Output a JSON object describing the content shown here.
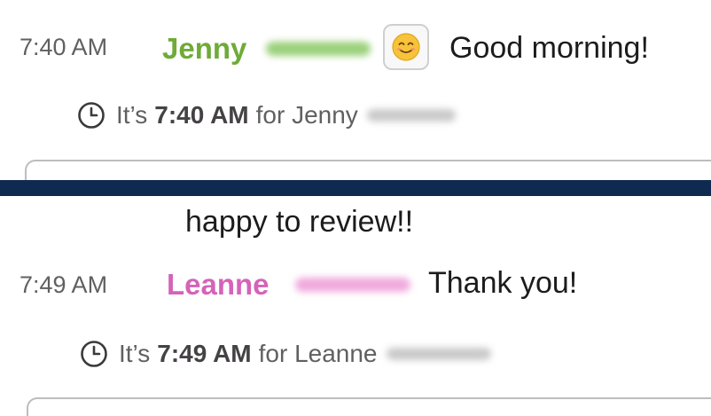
{
  "message1": {
    "timestamp": "7:40 AM",
    "sender": "Jenny",
    "sender_color": "#6eab38",
    "emoji": "smiling-face-emoji",
    "text": "Good morning!",
    "local_time": {
      "prefix": "It’s",
      "time": "7:40 AM",
      "suffix": "for Jenny"
    }
  },
  "message2": {
    "continuation_text": "happy to review!!",
    "timestamp": "7:49 AM",
    "sender": "Leanne",
    "sender_color": "#d563b8",
    "text": "Thank you!",
    "local_time": {
      "prefix": "It’s",
      "time": "7:49 AM",
      "suffix": "for Leanne"
    }
  },
  "colors": {
    "divider": "#0e2a50",
    "timestamp_text": "#616061"
  }
}
